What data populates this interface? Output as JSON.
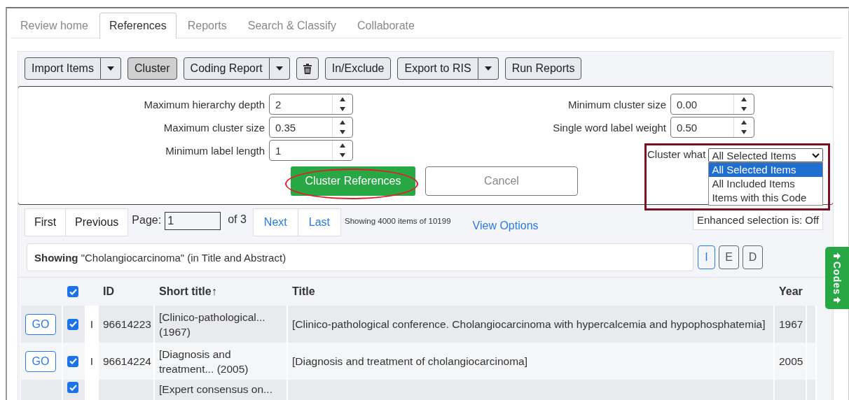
{
  "tabs": [
    {
      "label": "Review home",
      "selected": false
    },
    {
      "label": "References",
      "selected": true
    },
    {
      "label": "Reports",
      "selected": false
    },
    {
      "label": "Search & Classify",
      "selected": false
    },
    {
      "label": "Collaborate",
      "selected": false
    }
  ],
  "toolbar": [
    {
      "kind": "split",
      "label": "Import Items",
      "pressed": false
    },
    {
      "kind": "button",
      "label": "Cluster",
      "pressed": true
    },
    {
      "kind": "split",
      "label": "Coding Report",
      "pressed": false
    },
    {
      "kind": "icon",
      "pressed": false
    },
    {
      "kind": "button",
      "label": "In/Exclude",
      "pressed": false
    },
    {
      "kind": "split",
      "label": "Export to RIS",
      "pressed": false
    },
    {
      "kind": "button",
      "label": "Run Reports",
      "pressed": false
    }
  ],
  "cluster_panel": {
    "fields": [
      {
        "label": "Maximum hierarchy depth",
        "value": "2"
      },
      {
        "label": "Minimum cluster size",
        "value": "0.00"
      },
      {
        "label": "Maximum cluster size",
        "value": "0.35"
      },
      {
        "label": "Single word label weight",
        "value": "0.50"
      },
      {
        "label": "Minimum label length",
        "value": "1"
      }
    ],
    "cluster_what": {
      "label": "Cluster what",
      "value": "All Selected Items",
      "expanded": true,
      "options": [
        {
          "label": "All Selected Items",
          "selected": true
        },
        {
          "label": "All Included Items",
          "selected": false
        },
        {
          "label": "Items with this Code",
          "selected": false
        }
      ]
    },
    "run_button": "Cluster References",
    "cancel_button": "Cancel"
  },
  "pagination": {
    "first": "First",
    "previous": "Previous",
    "page_label": "Page:",
    "page_value": "1",
    "of": "of 3",
    "next": "Next",
    "last": "Last",
    "summary": "Showing 4000 items of 10199",
    "view_options": "View Options",
    "enhanced_selection": "Enhanced selection is: Off"
  },
  "filter": {
    "text": "**Showing** \"Cholangiocarcinoma\" (in Title and Abstract)",
    "buttons": [
      {
        "label": "I",
        "selected": true
      },
      {
        "label": "E",
        "selected": false
      },
      {
        "label": "D",
        "selected": false
      }
    ]
  },
  "table": {
    "select_all_checked": true,
    "columns": [
      "ID",
      "Short title↑",
      "Title",
      "Year"
    ],
    "rows": [
      {
        "action": "GO",
        "checked": true,
        "flag": "I",
        "id": "96614223",
        "short_title": "[Clinico-pathological... (1967)",
        "title": "[Clinico-pathological conference. Cholangiocarcinoma with hypercalcemia and hypophosphatemia]",
        "year": "1967"
      },
      {
        "action": "GO",
        "checked": true,
        "flag": "I",
        "id": "96614224",
        "short_title": "[Diagnosis and treatment... (2005)",
        "title": "[Diagnosis and treatment of cholangiocarcinoma]",
        "year": "2005"
      },
      {
        "checked": true,
        "short_title": "[Expert consensus on..."
      }
    ]
  },
  "codes_tab": {
    "label": "Codes"
  }
}
